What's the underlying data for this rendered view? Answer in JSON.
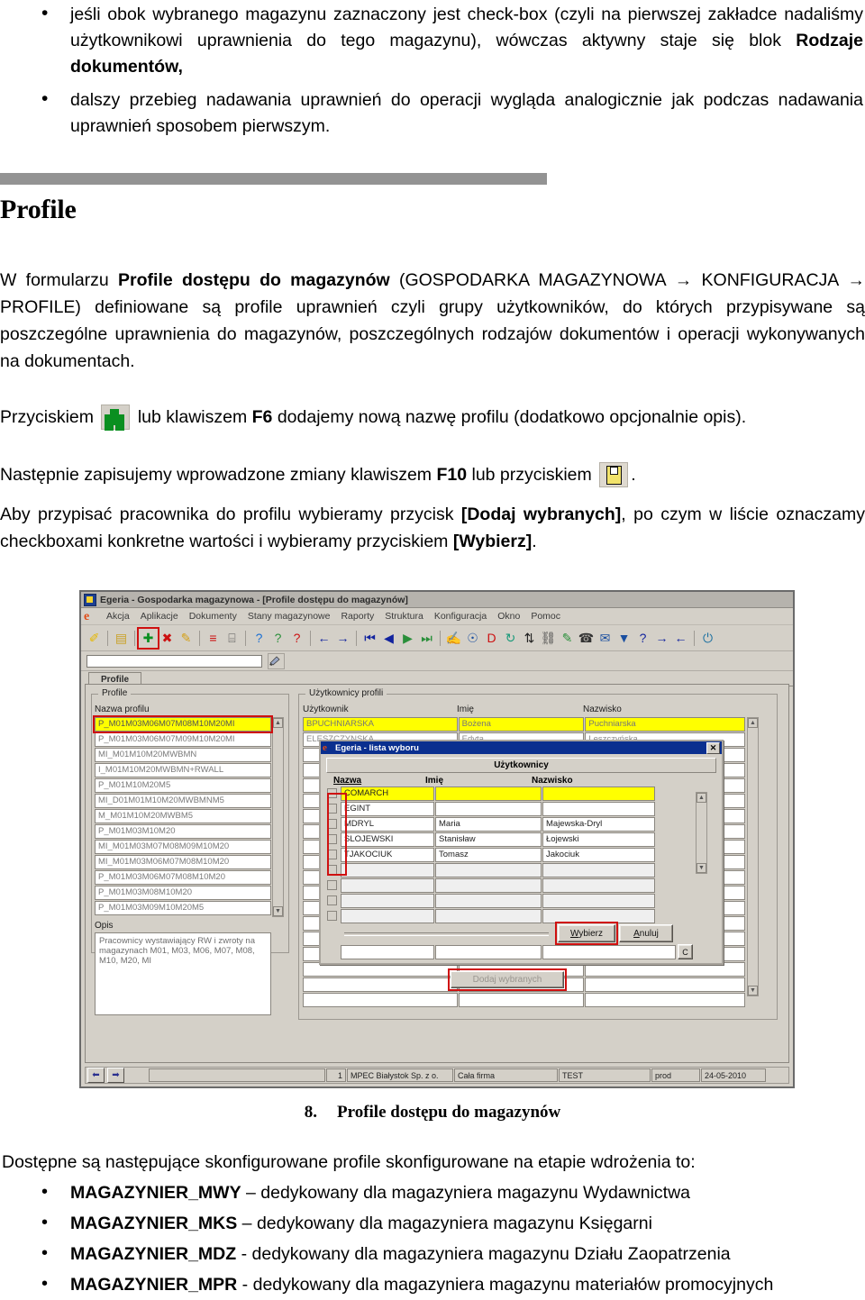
{
  "intro_bullets": [
    "jeśli obok wybranego magazynu zaznaczony jest check-box (czyli na pierwszej zakładce nadaliśmy użytkownikowi uprawnienia do tego magazynu), wówczas aktywny staje się blok",
    "dalszy przebieg nadawania uprawnień do operacji wygląda analogicznie jak podczas nadawania uprawnień sposobem pierwszym."
  ],
  "intro_bullet1_bold_tail": "Rodzaje dokumentów,",
  "heading": "Profile",
  "paragraph": {
    "p1_a": "W formularzu ",
    "p1_b": "Profile dostępu do magazynów",
    "p1_c": " (GOSPODARKA MAGAZYNOWA → KONFIGURACJA → PROFILE) definiowane są profile uprawnień czyli grupy użytkowników, do których przypisywane są poszczególne uprawnienia do magazynów, poszczególnych rodzajów dokumentów i operacji wykonywanych na dokumentach.",
    "p2_a": "Przyciskiem ",
    "p2_b": " lub klawiszem ",
    "p2_key": "F6",
    "p2_c": " dodajemy nową nazwę profilu (dodatkowo opcjonalnie opis).",
    "p3_a": "Następnie zapisujemy wprowadzone zmiany klawiszem ",
    "p3_key": "F10",
    "p3_b": " lub przyciskiem ",
    "p3_c": ".",
    "p4_a": "Aby przypisać pracownika do profilu wybieramy przycisk ",
    "p4_b": "[Dodaj wybranych]",
    "p4_c": ", po czym w liście oznaczamy checkboxami konkretne wartości i wybieramy przyciskiem ",
    "p4_d": "[Wybierz]",
    "p4_e": "."
  },
  "screenshot": {
    "window_title": "Egeria - Gospodarka magazynowa - [Profile dostępu do magazynów]",
    "window_icon": "app-icon",
    "menu": [
      "Akcja",
      "Aplikacje",
      "Dokumenty",
      "Stany magazynowe",
      "Raporty",
      "Struktura",
      "Konfiguracja",
      "Okno",
      "Pomoc"
    ],
    "toolbar_icons": [
      {
        "name": "pin-icon",
        "glyph": "✐",
        "color": "#e6b800"
      },
      {
        "name": "sep",
        "glyph": "",
        "color": ""
      },
      {
        "name": "save-icon",
        "glyph": "▤",
        "color": "#c9a227"
      },
      {
        "name": "sep",
        "glyph": "",
        "color": ""
      },
      {
        "name": "add-record-icon",
        "glyph": "✚",
        "color": "#0a8f20",
        "highlight": true
      },
      {
        "name": "delete-record-icon",
        "glyph": "✖",
        "color": "#cc1111"
      },
      {
        "name": "edit-record-icon",
        "glyph": "✎",
        "color": "#d4a017"
      },
      {
        "name": "sep",
        "glyph": "",
        "color": ""
      },
      {
        "name": "insert-row-icon",
        "glyph": "≡",
        "color": "#cc1111"
      },
      {
        "name": "duplicate-row-icon",
        "glyph": "⌸",
        "color": "#555555"
      },
      {
        "name": "sep",
        "glyph": "",
        "color": ""
      },
      {
        "name": "query-icon",
        "glyph": "?",
        "color": "#1a6fd4"
      },
      {
        "name": "query-execute-icon",
        "glyph": "?",
        "color": "#2a8f3a"
      },
      {
        "name": "query-count-icon",
        "glyph": "?",
        "color": "#cc1111"
      },
      {
        "name": "sep",
        "glyph": "",
        "color": ""
      },
      {
        "name": "prev-block-icon",
        "glyph": "←",
        "color": "#12239e"
      },
      {
        "name": "next-block-icon",
        "glyph": "→",
        "color": "#12239e"
      },
      {
        "name": "sep",
        "glyph": "",
        "color": ""
      },
      {
        "name": "first-record-icon",
        "glyph": "⏮",
        "color": "#12239e"
      },
      {
        "name": "prev-record-icon",
        "glyph": "◀",
        "color": "#12239e"
      },
      {
        "name": "next-record-icon",
        "glyph": "▶",
        "color": "#2a8f3a"
      },
      {
        "name": "last-record-icon",
        "glyph": "⏭",
        "color": "#2a8f3a"
      },
      {
        "name": "sep",
        "glyph": "",
        "color": ""
      },
      {
        "name": "notes-icon",
        "glyph": "✍",
        "color": "#3a3a7a"
      },
      {
        "name": "attach-icon",
        "glyph": "☉",
        "color": "#1a4fa0"
      },
      {
        "name": "document-icon",
        "glyph": "D",
        "color": "#cc1111"
      },
      {
        "name": "refresh-icon",
        "glyph": "↻",
        "color": "#1a9a7a"
      },
      {
        "name": "sort-icon",
        "glyph": "⇅",
        "color": "#222222"
      },
      {
        "name": "hierarchy-icon",
        "glyph": "⛓",
        "color": "#444444"
      },
      {
        "name": "palette-icon",
        "glyph": "✎",
        "color": "#2a8f3a"
      },
      {
        "name": "phone-icon",
        "glyph": "☎",
        "color": "#333333"
      },
      {
        "name": "mail-icon",
        "glyph": "✉",
        "color": "#1a4fa0"
      },
      {
        "name": "filter-icon",
        "glyph": "▼",
        "color": "#1a4fa0"
      },
      {
        "name": "help-icon",
        "glyph": "?",
        "color": "#12239e"
      },
      {
        "name": "forward-icon",
        "glyph": "→",
        "color": "#12239e"
      },
      {
        "name": "back-icon",
        "glyph": "←",
        "color": "#12239e"
      },
      {
        "name": "sep",
        "glyph": "",
        "color": ""
      },
      {
        "name": "exit-icon",
        "glyph": "⏻",
        "color": "#1a6fa0"
      }
    ],
    "filter_value": "",
    "filter_placeholder": "",
    "tab_label": "Profile",
    "profile_group_label": "Profile",
    "profile_column_label": "Nazwa profilu",
    "profiles": [
      "P_M01M03M06M07M08M10M20MI",
      "P_M01M03M06M07M09M10M20MI",
      "MI_M01M10M20MWBMN",
      "I_M01M10M20MWBMN+RWALL",
      "P_M01M10M20M5",
      "MI_D01M01M10M20MWBMNM5",
      "M_M01M10M20MWBM5",
      "P_M01M03M10M20",
      "MI_M01M03M07M08M09M10M20",
      "MI_M01M03M06M07M08M10M20",
      "P_M01M03M06M07M08M10M20",
      "P_M01M03M08M10M20",
      "P_M01M03M09M10M20M5"
    ],
    "selected_profile_index": 0,
    "opis_label": "Opis",
    "opis_text": "Pracownicy wystawiający RW i zwroty na magazynach M01, M03, M06, M07, M08, M10, M20, MI",
    "users_group_label": "Użytkownicy profili",
    "users_columns": [
      "Użytkownik",
      "Imię",
      "Nazwisko"
    ],
    "users_rows": [
      {
        "uzytkownik": "BPUCHNIARSKA",
        "imie": "Bożena",
        "nazwisko": "Puchniarska",
        "selected": true
      },
      {
        "uzytkownik": "ELESZCZYNSKA",
        "imie": "Edyta",
        "nazwisko": "Leszczyńska",
        "selected": false
      }
    ],
    "dialog": {
      "title": "Egeria - lista wyboru",
      "close_label": "✕",
      "banner": "Użytkownicy",
      "columns": [
        "Nazwa",
        "Imię",
        "Nazwisko"
      ],
      "rows": [
        {
          "nazwa": "COMARCH",
          "imie": "",
          "nazwisko": "",
          "checked": false,
          "selected": true
        },
        {
          "nazwa": "EGINT",
          "imie": "",
          "nazwisko": "",
          "checked": false,
          "selected": false
        },
        {
          "nazwa": "MDRYL",
          "imie": "Maria",
          "nazwisko": "Majewska-Dryl",
          "checked": false,
          "selected": false
        },
        {
          "nazwa": "SLOJEWSKI",
          "imie": "Stanisław",
          "nazwisko": "Łojewski",
          "checked": false,
          "selected": false
        },
        {
          "nazwa": "TJAKOCIUK",
          "imie": "Tomasz",
          "nazwisko": "Jakociuk",
          "checked": false,
          "selected": false
        }
      ],
      "empty_rows": 4,
      "select_button": "Wybierz",
      "cancel_button": "Anuluj",
      "c_button": "C"
    },
    "add_selected_button": "Dodaj wybranych",
    "statusbar": {
      "prev_icon": "⬅",
      "next_icon": "➡",
      "message": "",
      "record_no": "1",
      "company": "MPEC Białystok Sp. z o.",
      "scope": "Cała firma",
      "env": "TEST",
      "db": "prod",
      "date": "24-05-2010"
    }
  },
  "figure_caption": {
    "number": "8.",
    "text": "Profile dostępu do magazynów"
  },
  "tail": {
    "lead": "Dostępne są następujące skonfigurowane profile skonfigurowane na etapie wdrożenia to:",
    "items": [
      {
        "name": "MAGAZYNIER_MWY",
        "desc": " – dedykowany dla magazyniera magazynu Wydawnictwa"
      },
      {
        "name": "MAGAZYNIER_MKS",
        "desc": " – dedykowany dla magazyniera magazynu Księgarni"
      },
      {
        "name": "MAGAZYNIER_MDZ",
        "desc": " - dedykowany dla magazyniera magazynu Działu Zaopatrzenia"
      },
      {
        "name": "MAGAZYNIER_MPR",
        "desc": " - dedykowany dla magazyniera magazynu materiałów promocyjnych"
      }
    ]
  },
  "colors": {
    "selection_yellow": "#ffff00",
    "highlight_red": "#cf1010",
    "dialog_titlebar_blue": "#0a2f8f",
    "window_face": "#d4d0c8",
    "rule_gray": "#939393"
  }
}
